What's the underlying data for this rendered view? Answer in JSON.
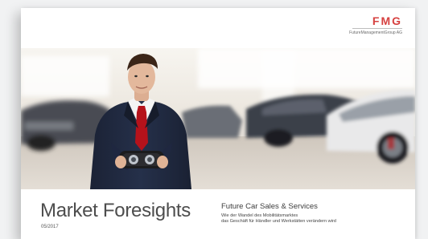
{
  "logo": {
    "mark": "FMG",
    "subtitle": "FutureManagementGroup AG"
  },
  "cover": {
    "title": "Market Foresights",
    "date": "05/2017",
    "headline": "Future Car Sales & Services",
    "subline_1": "Wie der Wandel des Mobilitätsmarktes",
    "subline_2": "das Geschäft für Händler und Werkstätten verändern wird"
  },
  "image": {
    "description_icon": "man-holding-vr-headset-in-car-showroom"
  },
  "colors": {
    "brand_red": "#d6403f",
    "text_gray": "#4d4d4d"
  }
}
